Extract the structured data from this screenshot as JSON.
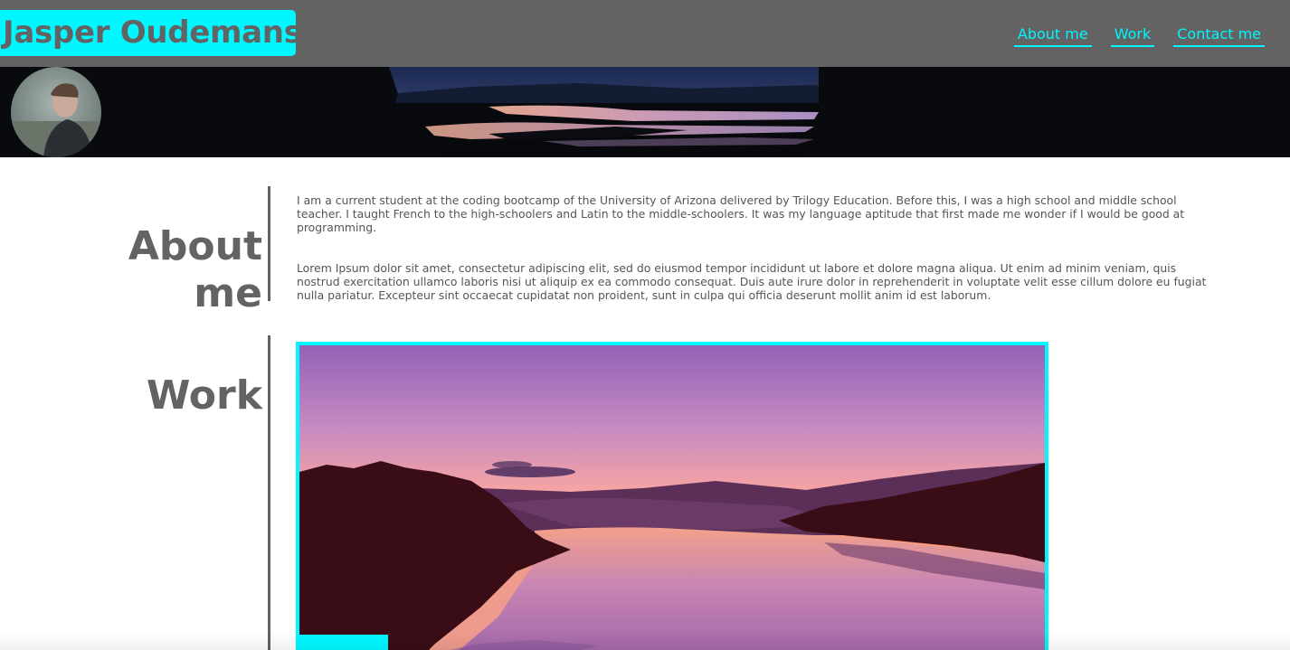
{
  "header": {
    "brand": "Jasper Oudemans",
    "nav": [
      {
        "label": "About me"
      },
      {
        "label": "Work"
      },
      {
        "label": "Contact me"
      }
    ]
  },
  "colors": {
    "accent": "#00f7ff",
    "header_bg": "#636363",
    "heading_text": "#636363"
  },
  "about": {
    "title_line1": "About",
    "title_line2": "me",
    "paragraph1": "I am a current student at the coding bootcamp of the University of Arizona delivered by Trilogy Education. Before this, I was a high school and middle school teacher. I taught French to the high-schoolers and Latin to the middle-schoolers. It was my language aptitude that first made me wonder if I would be good at programming.",
    "paragraph2": "Lorem Ipsum dolor sit amet, consectetur adipiscing elit, sed do eiusmod tempor incididunt ut labore et dolore magna aliqua. Ut enim ad minim veniam, quis nostrud exercitation ullamco laboris nisi ut aliquip ex ea commodo consequat. Duis aute irure dolor in reprehenderit in voluptate velit esse cillum dolore eu fugiat nulla pariatur. Excepteur sint occaecat cupidatat non proident, sunt in culpa qui officia deserunt mollit anim id est laborum."
  },
  "work": {
    "title": "Work"
  }
}
